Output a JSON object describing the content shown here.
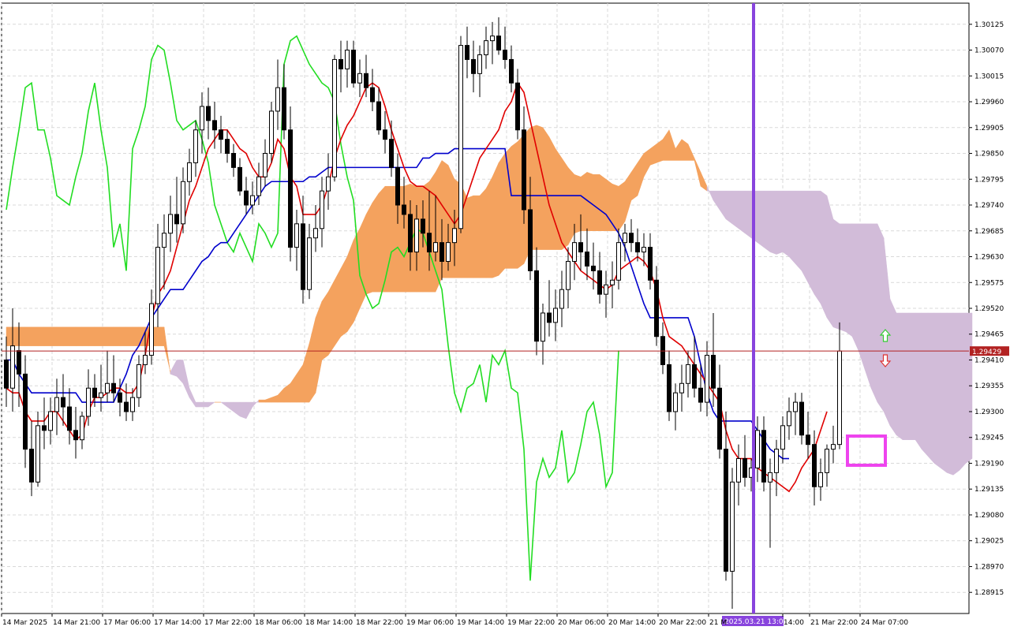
{
  "chart_data": {
    "type": "candlestick",
    "timeframe_labels": [
      "14 Mar 2025",
      "14 Mar 21:00",
      "17 Mar 06:00",
      "17 Mar 14:00",
      "17 Mar 22:00",
      "18 Mar 06:00",
      "18 Mar 14:00",
      "18 Mar 22:00",
      "19 Mar 06:00",
      "19 Mar 14:00",
      "19 Mar 22:00",
      "20 Mar 06:00",
      "20 Mar 14:00",
      "20 Mar 22:00",
      "21 M",
      "14:00",
      "21 Mar 22:00",
      "24 Mar 07:00"
    ],
    "y_ticks": [
      1.30125,
      1.3007,
      1.30015,
      1.2996,
      1.29905,
      1.2985,
      1.29795,
      1.2974,
      1.29685,
      1.2963,
      1.29575,
      1.2952,
      1.29465,
      1.2941,
      1.29355,
      1.293,
      1.29245,
      1.2919,
      1.29135,
      1.2908,
      1.29025,
      1.2897,
      1.28915
    ],
    "ylim": [
      1.2887,
      1.3017
    ],
    "current_price": "1.29429",
    "current_price_value": 1.29429,
    "marker_time_label": "2025.03.21 13:00",
    "colors": {
      "grid": "#d9d9d9",
      "price_line": "#b22222",
      "tenkan": "#e00000",
      "kijun": "#0000cc",
      "chikou": "#22dd22",
      "cloud_bull": "#f4a25e",
      "cloud_bear": "#d2bcd9",
      "vline": "#8844dd",
      "highlight_box": "#ee44ee",
      "price_badge": "#b22222",
      "time_badge": "#8844dd"
    },
    "candles": [
      [
        1.2941,
        1.2946,
        1.2931,
        1.2935
      ],
      [
        1.2935,
        1.2952,
        1.293,
        1.2944
      ],
      [
        1.2943,
        1.2949,
        1.2931,
        1.2938
      ],
      [
        1.2938,
        1.2942,
        1.2918,
        1.2922
      ],
      [
        1.2922,
        1.2928,
        1.2912,
        1.2915
      ],
      [
        1.2915,
        1.293,
        1.2914,
        1.2927
      ],
      [
        1.2927,
        1.2933,
        1.2922,
        1.2926
      ],
      [
        1.2926,
        1.2933,
        1.2923,
        1.293
      ],
      [
        1.293,
        1.2937,
        1.2925,
        1.2933
      ],
      [
        1.2933,
        1.2938,
        1.2927,
        1.2931
      ],
      [
        1.2931,
        1.2935,
        1.2923,
        1.2926
      ],
      [
        1.2926,
        1.2931,
        1.292,
        1.2924
      ],
      [
        1.2924,
        1.293,
        1.2922,
        1.2929
      ],
      [
        1.2929,
        1.2939,
        1.2927,
        1.2935
      ],
      [
        1.2935,
        1.2938,
        1.2931,
        1.2933
      ],
      [
        1.2933,
        1.294,
        1.293,
        1.2934
      ],
      [
        1.2934,
        1.2943,
        1.2932,
        1.2936
      ],
      [
        1.2936,
        1.2942,
        1.2932,
        1.2934
      ],
      [
        1.2934,
        1.2937,
        1.2929,
        1.2932
      ],
      [
        1.2932,
        1.2936,
        1.2928,
        1.293
      ],
      [
        1.293,
        1.2935,
        1.2928,
        1.2933
      ],
      [
        1.2933,
        1.2942,
        1.2931,
        1.294
      ],
      [
        1.294,
        1.2947,
        1.2938,
        1.2942
      ],
      [
        1.2942,
        1.2956,
        1.294,
        1.2953
      ],
      [
        1.2953,
        1.297,
        1.2948,
        1.2965
      ],
      [
        1.2965,
        1.2972,
        1.2956,
        1.2968
      ],
      [
        1.2968,
        1.2976,
        1.2964,
        1.2972
      ],
      [
        1.2972,
        1.298,
        1.2966,
        1.297
      ],
      [
        1.297,
        1.2982,
        1.2968,
        1.2979
      ],
      [
        1.2979,
        1.2986,
        1.2976,
        1.2983
      ],
      [
        1.2983,
        1.2992,
        1.298,
        1.299
      ],
      [
        1.299,
        1.2998,
        1.2985,
        1.2995
      ],
      [
        1.2995,
        1.2999,
        1.2988,
        1.2992
      ],
      [
        1.2992,
        1.2996,
        1.2986,
        1.299
      ],
      [
        1.299,
        1.2993,
        1.2985,
        1.2988
      ],
      [
        1.2988,
        1.299,
        1.2983,
        1.2985
      ],
      [
        1.2985,
        1.2987,
        1.298,
        1.2982
      ],
      [
        1.2982,
        1.2984,
        1.2976,
        1.2977
      ],
      [
        1.2977,
        1.298,
        1.2972,
        1.2974
      ],
      [
        1.2974,
        1.2979,
        1.2972,
        1.2976
      ],
      [
        1.2976,
        1.2983,
        1.2974,
        1.298
      ],
      [
        1.298,
        1.2988,
        1.2978,
        1.2985
      ],
      [
        1.2985,
        1.2996,
        1.2983,
        1.2994
      ],
      [
        1.2994,
        1.3005,
        1.299,
        1.2999
      ],
      [
        1.2999,
        1.3004,
        1.2988,
        1.299
      ],
      [
        1.299,
        1.2995,
        1.2962,
        1.2965
      ],
      [
        1.2965,
        1.2973,
        1.296,
        1.297
      ],
      [
        1.297,
        1.2976,
        1.2953,
        1.2956
      ],
      [
        1.2956,
        1.297,
        1.2954,
        1.2967
      ],
      [
        1.2967,
        1.2974,
        1.2964,
        1.2969
      ],
      [
        1.2969,
        1.298,
        1.2965,
        1.2977
      ],
      [
        1.2977,
        1.2985,
        1.2973,
        1.298
      ],
      [
        1.298,
        1.3006,
        1.2979,
        1.3005
      ],
      [
        1.3005,
        1.3009,
        1.2998,
        1.3003
      ],
      [
        1.3003,
        1.3009,
        1.2999,
        1.3007
      ],
      [
        1.3007,
        1.3009,
        1.2999,
        1.3
      ],
      [
        1.3,
        1.3005,
        1.2997,
        1.3002
      ],
      [
        1.3002,
        1.3006,
        1.2997,
        1.2999
      ],
      [
        1.2999,
        1.3003,
        1.2994,
        1.2996
      ],
      [
        1.2996,
        1.2999,
        1.2989,
        1.299
      ],
      [
        1.299,
        1.2994,
        1.2985,
        1.2988
      ],
      [
        1.2988,
        1.2992,
        1.298,
        1.2982
      ],
      [
        1.2982,
        1.2985,
        1.297,
        1.2974
      ],
      [
        1.2974,
        1.298,
        1.2969,
        1.2972
      ],
      [
        1.2972,
        1.2975,
        1.296,
        1.2964
      ],
      [
        1.2964,
        1.2974,
        1.296,
        1.2971
      ],
      [
        1.2971,
        1.2975,
        1.2965,
        1.2968
      ],
      [
        1.2968,
        1.2977,
        1.296,
        1.2964
      ],
      [
        1.2964,
        1.2976,
        1.2962,
        1.2966
      ],
      [
        1.2966,
        1.2971,
        1.2958,
        1.2962
      ],
      [
        1.2962,
        1.297,
        1.296,
        1.2966
      ],
      [
        1.2966,
        1.2973,
        1.2961,
        1.2969
      ],
      [
        1.2969,
        1.301,
        1.2968,
        1.3008
      ],
      [
        1.3008,
        1.3012,
        1.3001,
        1.3005
      ],
      [
        1.3005,
        1.3009,
        1.2998,
        1.3002
      ],
      [
        1.3002,
        1.3008,
        1.2997,
        1.3006
      ],
      [
        1.3006,
        1.3012,
        1.3003,
        1.3009
      ],
      [
        1.3009,
        1.3013,
        1.3004,
        1.301
      ],
      [
        1.301,
        1.3014,
        1.3006,
        1.3007
      ],
      [
        1.3007,
        1.3012,
        1.3003,
        1.3005
      ],
      [
        1.3005,
        1.3008,
        1.2998,
        1.3
      ],
      [
        1.3,
        1.3003,
        1.2988,
        1.299
      ],
      [
        1.299,
        1.2995,
        1.297,
        1.2973
      ],
      [
        1.2973,
        1.298,
        1.2958,
        1.296
      ],
      [
        1.296,
        1.2965,
        1.2942,
        1.2945
      ],
      [
        1.2945,
        1.2953,
        1.294,
        1.2951
      ],
      [
        1.2951,
        1.2958,
        1.2946,
        1.2949
      ],
      [
        1.2949,
        1.2956,
        1.2945,
        1.2952
      ],
      [
        1.2952,
        1.296,
        1.2948,
        1.2956
      ],
      [
        1.2956,
        1.2965,
        1.2952,
        1.2962
      ],
      [
        1.2962,
        1.297,
        1.2958,
        1.2966
      ],
      [
        1.2966,
        1.2972,
        1.296,
        1.2964
      ],
      [
        1.2964,
        1.2969,
        1.2958,
        1.2961
      ],
      [
        1.2961,
        1.2966,
        1.2956,
        1.296
      ],
      [
        1.296,
        1.2964,
        1.2953,
        1.2955
      ],
      [
        1.2955,
        1.296,
        1.295,
        1.2957
      ],
      [
        1.2957,
        1.2962,
        1.2952,
        1.2958
      ],
      [
        1.2958,
        1.2969,
        1.2956,
        1.2966
      ],
      [
        1.2966,
        1.297,
        1.2962,
        1.2968
      ],
      [
        1.2968,
        1.2971,
        1.2964,
        1.2966
      ],
      [
        1.2966,
        1.2969,
        1.2962,
        1.2964
      ],
      [
        1.2964,
        1.2968,
        1.2961,
        1.2965
      ],
      [
        1.2965,
        1.2968,
        1.2956,
        1.2958
      ],
      [
        1.2958,
        1.2961,
        1.2944,
        1.2946
      ],
      [
        1.2946,
        1.2949,
        1.2938,
        1.294
      ],
      [
        1.294,
        1.2943,
        1.2928,
        1.293
      ],
      [
        1.293,
        1.2936,
        1.2926,
        1.2934
      ],
      [
        1.2934,
        1.294,
        1.293,
        1.2936
      ],
      [
        1.2936,
        1.2943,
        1.2933,
        1.294
      ],
      [
        1.294,
        1.2946,
        1.2933,
        1.2935
      ],
      [
        1.2935,
        1.294,
        1.293,
        1.2932
      ],
      [
        1.2932,
        1.2945,
        1.2929,
        1.2942
      ],
      [
        1.2942,
        1.2951,
        1.2931,
        1.2935
      ],
      [
        1.2935,
        1.294,
        1.292,
        1.2922
      ],
      [
        1.2922,
        1.293,
        1.2894,
        1.2896
      ],
      [
        1.2896,
        1.2918,
        1.2888,
        1.2915
      ],
      [
        1.2915,
        1.2923,
        1.291,
        1.292
      ],
      [
        1.292,
        1.2925,
        1.2914,
        1.2916
      ],
      [
        1.2916,
        1.292,
        1.2913,
        1.2918
      ],
      [
        1.2918,
        1.2929,
        1.2915,
        1.2926
      ],
      [
        1.2926,
        1.2929,
        1.2913,
        1.2915
      ],
      [
        1.2915,
        1.292,
        1.2901,
        1.2917
      ],
      [
        1.2917,
        1.2924,
        1.2912,
        1.2922
      ],
      [
        1.2922,
        1.2929,
        1.2919,
        1.2927
      ],
      [
        1.2927,
        1.2933,
        1.2924,
        1.293
      ],
      [
        1.293,
        1.2934,
        1.2925,
        1.2932
      ],
      [
        1.2932,
        1.2934,
        1.2923,
        1.2925
      ],
      [
        1.2925,
        1.293,
        1.292,
        1.2923
      ],
      [
        1.2923,
        1.2926,
        1.291,
        1.2914
      ],
      [
        1.2914,
        1.292,
        1.2911,
        1.2917
      ],
      [
        1.2917,
        1.2923,
        1.2914,
        1.2922
      ],
      [
        1.2922,
        1.2927,
        1.2919,
        1.2923
      ],
      [
        1.2923,
        1.2949,
        1.2922,
        1.29429
      ]
    ],
    "tenkan": [
      1.2935,
      1.2934,
      1.2934,
      1.293,
      1.2928,
      1.2928,
      1.2928,
      1.293,
      1.293,
      1.2928,
      1.2926,
      1.2924,
      1.2925,
      1.293,
      1.2933,
      1.2933,
      1.2934,
      1.2935,
      1.2935,
      1.2934,
      1.2934,
      1.2936,
      1.2942,
      1.295,
      1.2955,
      1.2957,
      1.296,
      1.2965,
      1.297,
      1.2975,
      1.2978,
      1.2982,
      1.2986,
      1.2988,
      1.299,
      1.299,
      1.2988,
      1.2986,
      1.2985,
      1.2982,
      1.298,
      1.298,
      1.2983,
      1.2988,
      1.2986,
      1.298,
      1.2978,
      1.2972,
      1.2972,
      1.2972,
      1.2974,
      1.2978,
      1.2984,
      1.2988,
      1.2991,
      1.2993,
      1.2996,
      1.2999,
      1.3,
      1.2999,
      1.2995,
      1.299,
      1.2986,
      1.2982,
      1.2979,
      1.2978,
      1.2978,
      1.2977,
      1.2976,
      1.2974,
      1.2972,
      1.297,
      1.2972,
      1.2976,
      1.298,
      1.2984,
      1.2986,
      1.2988,
      1.299,
      1.2994,
      1.2996,
      1.3,
      1.2998,
      1.2992,
      1.2986,
      1.298,
      1.2974,
      1.297,
      1.2966,
      1.2964,
      1.2962,
      1.296,
      1.2959,
      1.2958,
      1.2957,
      1.2956,
      1.2957,
      1.296,
      1.2961,
      1.2962,
      1.2963,
      1.2962,
      1.296,
      1.2956,
      1.295,
      1.2946,
      1.2945,
      1.2944,
      1.2942,
      1.294,
      1.2938,
      1.2936,
      1.2934,
      1.2932,
      1.2926,
      1.2922,
      1.292,
      1.292,
      1.292,
      1.2918,
      1.2917,
      1.2916,
      1.2915,
      1.2914,
      1.2913,
      1.2915,
      1.2918,
      1.292,
      1.2922,
      1.2926,
      1.293
    ],
    "kijun": [
      1.2941,
      1.2941,
      1.2938,
      1.2936,
      1.2934,
      1.2934,
      1.2934,
      1.2934,
      1.2934,
      1.2934,
      1.2934,
      1.2934,
      1.2932,
      1.2932,
      1.2932,
      1.2932,
      1.2932,
      1.2932,
      1.2935,
      1.2938,
      1.2942,
      1.2944,
      1.2947,
      1.295,
      1.2952,
      1.2954,
      1.2956,
      1.2956,
      1.2956,
      1.2958,
      1.296,
      1.2962,
      1.2963,
      1.2965,
      1.2966,
      1.2966,
      1.2968,
      1.297,
      1.2972,
      1.2974,
      1.2976,
      1.2978,
      1.2979,
      1.2979,
      1.2979,
      1.2979,
      1.2979,
      1.2979,
      1.298,
      1.298,
      1.2981,
      1.2982,
      1.2982,
      1.2982,
      1.2982,
      1.2982,
      1.2982,
      1.2982,
      1.2982,
      1.2982,
      1.2982,
      1.2982,
      1.2982,
      1.2982,
      1.2982,
      1.2982,
      1.2984,
      1.2984,
      1.2985,
      1.2985,
      1.2985,
      1.2986,
      1.2986,
      1.2986,
      1.2986,
      1.2986,
      1.2986,
      1.2986,
      1.2986,
      1.2986,
      1.2976,
      1.2976,
      1.2976,
      1.2976,
      1.2976,
      1.2976,
      1.2976,
      1.2976,
      1.2976,
      1.2976,
      1.2976,
      1.2976,
      1.2975,
      1.2974,
      1.2973,
      1.2972,
      1.297,
      1.2968,
      1.2965,
      1.2961,
      1.2957,
      1.2953,
      1.295,
      1.295,
      1.295,
      1.295,
      1.295,
      1.295,
      1.295,
      1.2946,
      1.294,
      1.2934,
      1.293,
      1.2928,
      1.2928,
      1.2928,
      1.2928,
      1.2928,
      1.2928,
      1.2926,
      1.2924,
      1.2922,
      1.2921,
      1.292,
      1.292
    ],
    "chikou": [
      1.2973,
      1.2982,
      1.299,
      1.2999,
      1.3,
      1.299,
      1.299,
      1.2984,
      1.2976,
      1.2975,
      1.2974,
      1.298,
      1.2985,
      1.2994,
      1.3,
      1.299,
      1.2982,
      1.2965,
      1.297,
      1.296,
      1.2986,
      1.299,
      1.2995,
      1.3005,
      1.3008,
      1.3007,
      1.3,
      1.2992,
      1.299,
      1.2991,
      1.2992,
      1.2988,
      1.2983,
      1.2974,
      1.297,
      1.2966,
      1.2964,
      1.2968,
      1.2965,
      1.2962,
      1.297,
      1.2968,
      1.2965,
      1.2968,
      1.3004,
      1.3009,
      1.301,
      1.3007,
      1.3004,
      1.3002,
      1.3,
      1.2999,
      1.2996,
      1.2987,
      1.298,
      1.2975,
      1.2959,
      1.2955,
      1.2952,
      1.2953,
      1.2958,
      1.2964,
      1.2965,
      1.2963,
      1.2966,
      1.2969,
      1.2968,
      1.2964,
      1.296,
      1.2956,
      1.2944,
      1.2934,
      1.293,
      1.2935,
      1.2936,
      1.294,
      1.2932,
      1.2942,
      1.294,
      1.2943,
      1.2935,
      1.2934,
      1.2922,
      1.2894,
      1.2915,
      1.292,
      1.2916,
      1.2918,
      1.2926,
      1.2915,
      1.2917,
      1.2923,
      1.293,
      1.2932,
      1.2925,
      1.2914,
      1.2917,
      1.2943
    ]
  }
}
